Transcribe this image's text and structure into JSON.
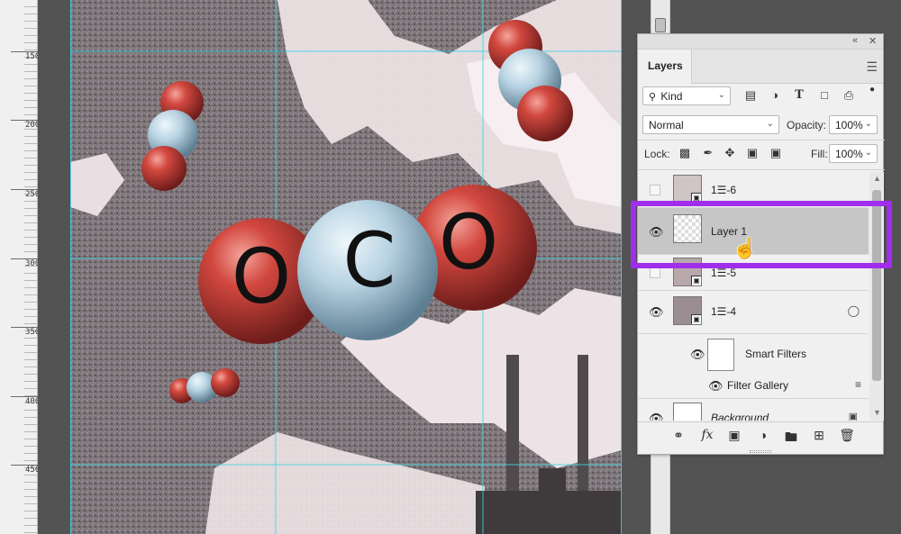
{
  "ruler": {
    "labels": [
      "150",
      "200",
      "250",
      "300",
      "350",
      "400",
      "450"
    ]
  },
  "canvas": {
    "molecule_letters": [
      "O",
      "C",
      "O"
    ],
    "colors": {
      "oxygen": "#c9443c",
      "carbon": "#b9d4e4",
      "guide": "#39d6e8",
      "smoke": "#7f777b",
      "sky": "#efe6e8"
    }
  },
  "panel": {
    "collapse_icon": "double-chevron-left-icon",
    "close_icon": "close-icon",
    "tab_label": "Layers",
    "menu_icon": "hamburger-menu-icon",
    "filter": {
      "kind_label": "Kind",
      "icons": [
        "image-filter-icon",
        "adjustment-filter-icon",
        "type-filter-icon",
        "shape-filter-icon",
        "smart-object-filter-icon",
        "filter-toggle-icon"
      ]
    },
    "blend_mode": "Normal",
    "opacity_label": "Opacity:",
    "opacity_value": "100%",
    "lock_label": "Lock:",
    "lock_icons": [
      "lock-transparent-icon",
      "lock-paint-icon",
      "lock-position-icon",
      "lock-artboard-icon",
      "lock-all-icon"
    ],
    "fill_label": "Fill:",
    "fill_value": "100%",
    "layers": [
      {
        "name": "1☰-6",
        "visible": false,
        "selected": false
      },
      {
        "name": "Layer 1",
        "visible": true,
        "selected": true
      },
      {
        "name": "1☰-5",
        "visible": false,
        "selected": false
      },
      {
        "name": "1☰-4",
        "visible": true,
        "selected": false
      },
      {
        "name": "Smart Filters",
        "visible": true,
        "selected": false
      },
      {
        "name": "Filter Gallery",
        "visible": true,
        "selected": false
      },
      {
        "name": "Background",
        "visible": true,
        "selected": false
      }
    ],
    "bottom_icons": [
      "link-layers-icon",
      "fx-icon",
      "layer-mask-icon",
      "adjustment-layer-icon",
      "new-group-icon",
      "new-layer-icon",
      "trash-icon"
    ],
    "fx_label": "fx"
  },
  "highlight_color": "#a12ded"
}
